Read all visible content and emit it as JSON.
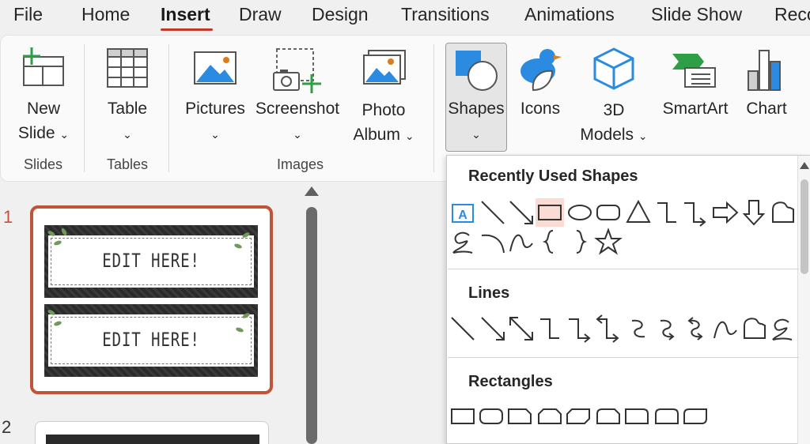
{
  "menu": {
    "tabs": [
      {
        "label": "File"
      },
      {
        "label": "Home"
      },
      {
        "label": "Insert"
      },
      {
        "label": "Draw"
      },
      {
        "label": "Design"
      },
      {
        "label": "Transitions"
      },
      {
        "label": "Animations"
      },
      {
        "label": "Slide Show"
      },
      {
        "label": "Reco"
      }
    ],
    "active_tab": "Insert"
  },
  "ribbon": {
    "groups": {
      "slides": "Slides",
      "tables": "Tables",
      "images": "Images"
    },
    "buttons": {
      "new_slide": {
        "line1": "New",
        "line2": "Slide",
        "icon": "new-slide-icon"
      },
      "table": {
        "line1": "Table",
        "icon": "table-icon"
      },
      "pictures": {
        "line1": "Pictures",
        "icon": "pictures-icon"
      },
      "screenshot": {
        "line1": "Screenshot",
        "icon": "screenshot-icon"
      },
      "photo_album": {
        "line1": "Photo",
        "line2": "Album",
        "icon": "photo-album-icon"
      },
      "shapes": {
        "line1": "Shapes",
        "icon": "shapes-icon"
      },
      "icons": {
        "line1": "Icons",
        "icon": "icons-icon"
      },
      "models_3d": {
        "line1": "3D",
        "line2": "Models",
        "icon": "3d-models-icon"
      },
      "smartart": {
        "line1": "SmartArt",
        "icon": "smartart-icon"
      },
      "chart": {
        "line1": "Chart",
        "icon": "chart-icon"
      }
    },
    "chevron": "⌄"
  },
  "slides_panel": {
    "slide1_number": "1",
    "slide2_number": "2",
    "slide1_label_text": "EDIT HERE!"
  },
  "shapes_dropdown": {
    "recently_used_title": "Recently Used Shapes",
    "lines_title": "Lines",
    "rectangles_title": "Rectangles",
    "selected_shape": "rectangle"
  },
  "colors": {
    "accent": "#c0392b",
    "slide_border": "#c0543a",
    "icon_blue": "#2b8be0",
    "selection": "#fbdcd5"
  }
}
